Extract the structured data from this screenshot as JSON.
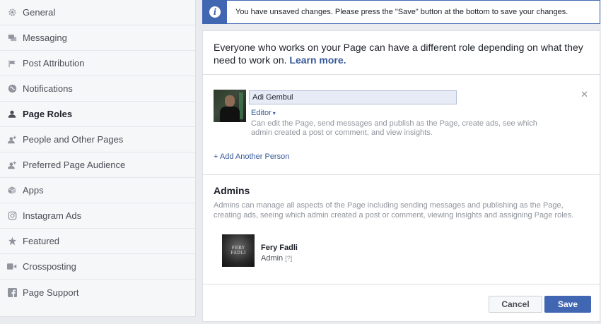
{
  "sidebar": {
    "items": [
      {
        "label": "General",
        "icon": "gear-icon"
      },
      {
        "label": "Messaging",
        "icon": "chat-icon"
      },
      {
        "label": "Post Attribution",
        "icon": "flag-icon"
      },
      {
        "label": "Notifications",
        "icon": "globe-icon"
      },
      {
        "label": "Page Roles",
        "icon": "person-icon",
        "active": true
      },
      {
        "label": "People and Other Pages",
        "icon": "person-plus-icon"
      },
      {
        "label": "Preferred Page Audience",
        "icon": "person-plus-icon"
      },
      {
        "label": "Apps",
        "icon": "cube-icon"
      },
      {
        "label": "Instagram Ads",
        "icon": "instagram-icon"
      },
      {
        "label": "Featured",
        "icon": "star-icon"
      },
      {
        "label": "Crossposting",
        "icon": "video-icon"
      },
      {
        "label": "Page Support",
        "icon": "facebook-icon"
      }
    ]
  },
  "notice": {
    "text": "You have unsaved changes. Please press the \"Save\" button at the bottom to save your changes."
  },
  "intro": {
    "text": "Everyone who works on your Page can have a different role depending on what they need to work on.",
    "link": "Learn more."
  },
  "add_person": {
    "name_value": "Adi Gembul",
    "role": "Editor",
    "role_description": "Can edit the Page, send messages and publish as the Page, create ads, see which admin created a post or comment, and view insights.",
    "add_another": "+ Add Another Person"
  },
  "admins": {
    "title": "Admins",
    "description": "Admins can manage all aspects of the Page including sending messages and publishing as the Page, creating ads, seeing which admin created a post or comment, viewing insights and assigning Page roles.",
    "list": [
      {
        "name": "Fery Fadli",
        "role": "Admin",
        "help": "[?]",
        "avatar_text": "FERY FADLI"
      }
    ]
  },
  "footer": {
    "cancel_label": "Cancel",
    "save_label": "Save"
  },
  "colors": {
    "accent": "#4267b2",
    "link": "#365899",
    "background": "#e9ebee"
  }
}
